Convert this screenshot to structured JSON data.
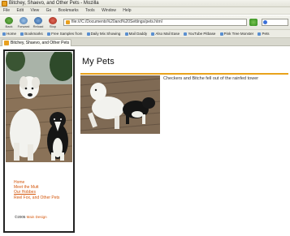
{
  "window": {
    "title": "Bitchey, Shaevo, and Other Pets - Mozilla"
  },
  "menu": [
    "File",
    "Edit",
    "View",
    "Go",
    "Bookmarks",
    "Tools",
    "Window",
    "Help"
  ],
  "toolbar": {
    "back_label": "Back",
    "forward_label": "Forward",
    "reload_label": "Reload",
    "stop_label": "Stop",
    "url": "file:///C:/Documents%20and%20Settings/pets.html"
  },
  "bookmarks": [
    "Home",
    "Bookmarks",
    "Free Samples from",
    "Daily Mix Showing",
    "Mail Daddy",
    "Also Mail Ease",
    "YouTube Pitbase",
    "Pink Tree Monster",
    "Pets"
  ],
  "tab": {
    "title": "Bitchey, Shaevo, and Other Pets"
  },
  "sidebar": {
    "nav": [
      "Home",
      "Meet the Mutt",
      "Our Hobbes",
      "Reel Fox, and Other Pets"
    ],
    "footer_text": "©2005",
    "footer_link": "Main Design"
  },
  "main": {
    "title": "My Pets",
    "caption": "Checkers and Bitche fell out of the rainfed tower"
  },
  "colors": {
    "accent": "#e9a21c",
    "link": "#d4570c"
  }
}
